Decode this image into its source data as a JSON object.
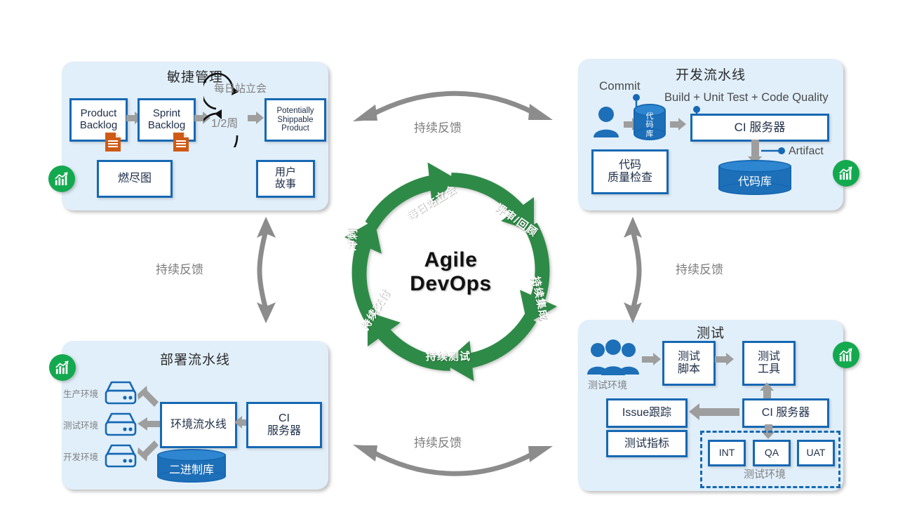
{
  "colors": {
    "panel_bg": "#e1effa",
    "box_border": "#1668b3",
    "arrow_grey": "#9e9e9e",
    "wheel_green": "#2e8b46",
    "badge_green": "#13a94f",
    "doc_orange": "#cf5a16",
    "cylinder_blue": "#1d6fb8"
  },
  "center": {
    "title_line1": "Agile",
    "title_line2": "DevOps",
    "segments": [
      {
        "label": "每日站立会",
        "name": "daily-standup"
      },
      {
        "label": "评审/回顾",
        "name": "review-retrospective"
      },
      {
        "label": "持续集成",
        "name": "continuous-integration"
      },
      {
        "label": "持续测试",
        "name": "continuous-testing"
      },
      {
        "label": "持续交付",
        "name": "continuous-delivery"
      },
      {
        "label": "冲刺",
        "name": "sprint"
      }
    ]
  },
  "connectors": {
    "top": "持续反馈",
    "bottom": "持续反馈",
    "left": "持续反馈",
    "right": "持续反馈"
  },
  "agile": {
    "title": "敏捷管理",
    "product_backlog": "Product\nBacklog",
    "product_backlog_l1": "Product",
    "product_backlog_l2": "Backlog",
    "sprint_backlog_l1": "Sprint",
    "sprint_backlog_l2": "Backlog",
    "daily_standup": "每日站立会",
    "iteration": "1/2周",
    "shippable_l1": "Potentially",
    "shippable_l2": "Shippable",
    "shippable_l3": "Product",
    "burndown": "燃尽图",
    "user_story_l1": "用户",
    "user_story_l2": "故事"
  },
  "dev": {
    "title": "开发流水线",
    "commit": "Commit",
    "build_label": "Build + Unit Test + Code Quality",
    "repo_cylinder": "代码库",
    "ci_server": "CI 服务器",
    "artifact": "Artifact",
    "code_quality_l1": "代码",
    "code_quality_l2": "质量检查",
    "artifact_repo": "代码库"
  },
  "deploy": {
    "title": "部署流水线",
    "env_prod": "生产环境",
    "env_test": "测试环境",
    "env_dev": "开发环境",
    "env_pipeline": "环境流水线",
    "ci_server_l1": "CI",
    "ci_server_l2": "服务器",
    "binary_repo": "二进制库"
  },
  "test": {
    "title": "测试",
    "test_env_people": "测试环境",
    "test_script_l1": "测试",
    "test_script_l2": "脚本",
    "test_tool_l1": "测试",
    "test_tool_l2": "工具",
    "issue_tracking": "Issue跟踪",
    "test_metrics": "测试指标",
    "ci_server": "CI 服务器",
    "envs": [
      "INT",
      "QA",
      "UAT"
    ],
    "env_group_label": "测试环境"
  },
  "badges": [
    {
      "name": "metrics-badge-agile",
      "icon": "chart-growth-icon"
    },
    {
      "name": "metrics-badge-dev",
      "icon": "chart-growth-icon"
    },
    {
      "name": "metrics-badge-deploy",
      "icon": "chart-growth-icon"
    },
    {
      "name": "metrics-badge-test",
      "icon": "chart-growth-icon"
    }
  ]
}
